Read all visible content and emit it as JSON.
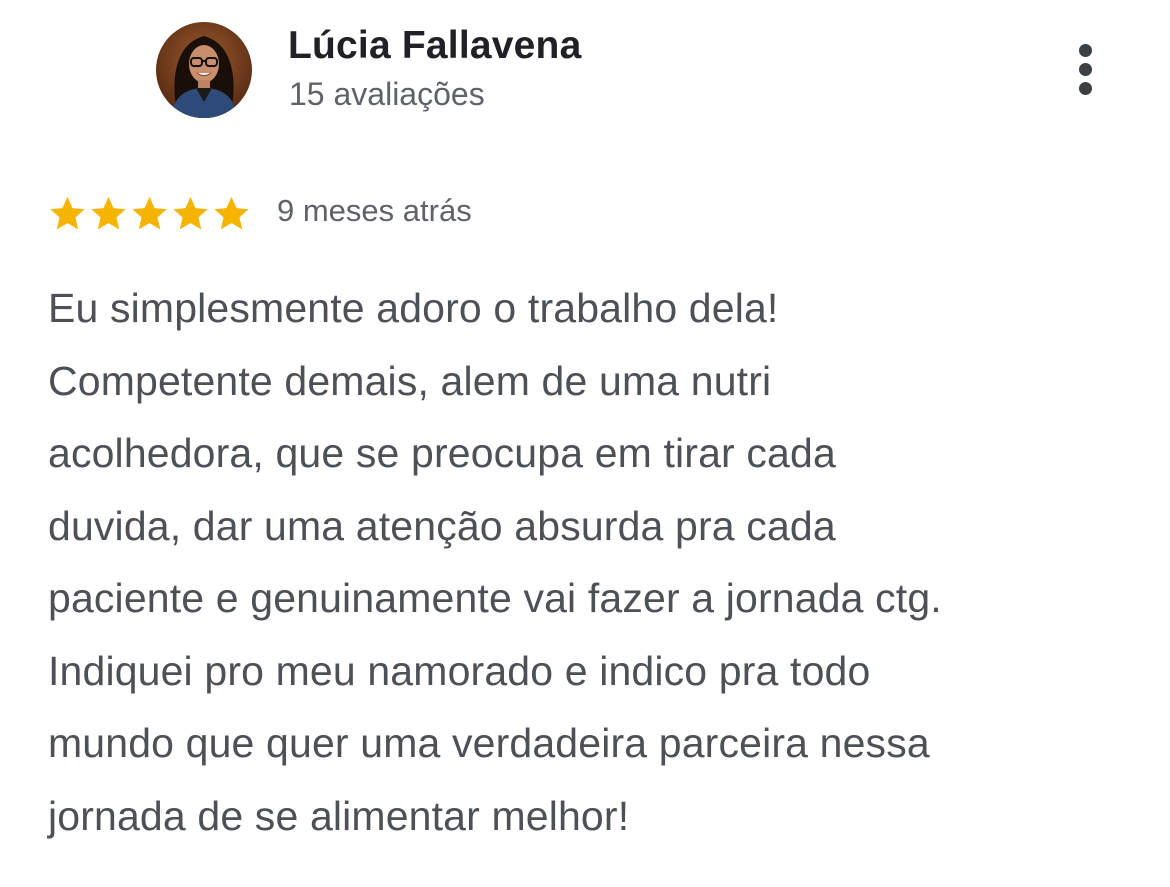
{
  "reviewer": {
    "name": "Lúcia Fallavena",
    "review_count": "15 avaliações",
    "avatar_icon": "avatar-photo"
  },
  "menu": {
    "icon": "more-vertical-icon"
  },
  "review": {
    "rating": 5,
    "rating_max": 5,
    "star_color": "#F5B400",
    "time_ago": "9 meses atrás",
    "text_lines": [
      "Eu simplesmente adoro o trabalho dela!",
      "Competente demais, alem de uma nutri",
      "acolhedora, que se preocupa em tirar cada",
      "duvida, dar uma atenção absurda pra cada",
      "paciente e genuinamente vai fazer a jornada ctg.",
      "Indiquei pro meu namorado e indico pra todo",
      "mundo que quer uma verdadeira parceira nessa",
      "jornada de se alimentar melhor!"
    ]
  }
}
